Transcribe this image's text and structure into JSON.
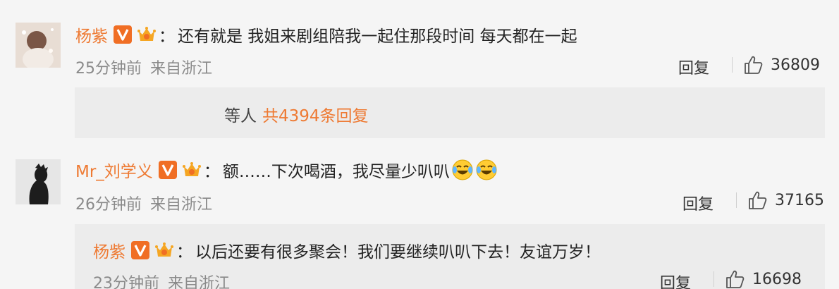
{
  "comments": [
    {
      "username": "杨紫",
      "text": "还有就是 我姐来剧组陪我一起住那段时间 每天都在一起",
      "time": "25分钟前",
      "source": "来自浙江",
      "reply_label": "回复",
      "likes": "36809"
    },
    {
      "username": "Mr_刘学义",
      "text": "额……下次喝酒，我尽量少叭叭",
      "time": "26分钟前",
      "source": "来自浙江",
      "reply_label": "回复",
      "likes": "37165"
    }
  ],
  "more_replies": {
    "prefix": "等人",
    "count_text": "共4394条回复"
  },
  "sub_reply": {
    "username": "杨紫",
    "text": "以后还要有很多聚会！我们要继续叭叭下去！友谊万岁！",
    "time": "23分钟前",
    "source": "来自浙江",
    "reply_label": "回复",
    "likes": "16698"
  },
  "colon": "：",
  "icons": {
    "verified_badge": "v-verified-badge-icon",
    "crown": "crown-fan-badge-icon",
    "like": "thumbs-up-icon",
    "emoji": "laugh-cry-emoji-icon"
  },
  "colors": {
    "username": "#ee7a33",
    "badge": "#f06e24",
    "meta": "#8a8a8a",
    "background": "#f5f5f5",
    "panel": "#ececec"
  }
}
